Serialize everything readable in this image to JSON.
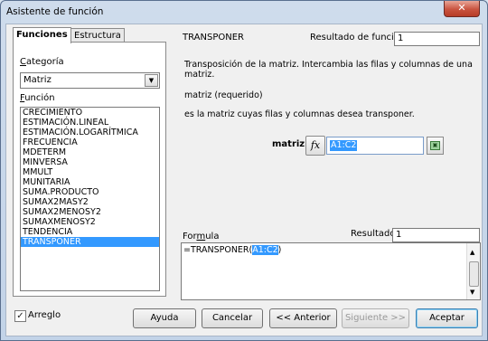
{
  "window": {
    "title": "Asistente de función",
    "close_glyph": "✕"
  },
  "tabs": {
    "funciones": "Funciones",
    "estructura": "Estructura"
  },
  "categoria": {
    "label": "Categoría",
    "value": "Matriz"
  },
  "funcion": {
    "label": "Función"
  },
  "functions": [
    {
      "label": "CRECIMIENTO",
      "selected": false
    },
    {
      "label": "ESTIMACIÓN.LINEAL",
      "selected": false
    },
    {
      "label": "ESTIMACIÓN.LOGARÍTMICA",
      "selected": false
    },
    {
      "label": "FRECUENCIA",
      "selected": false
    },
    {
      "label": "MDETERM",
      "selected": false
    },
    {
      "label": "MINVERSA",
      "selected": false
    },
    {
      "label": "MMULT",
      "selected": false
    },
    {
      "label": "MUNITARIA",
      "selected": false
    },
    {
      "label": "SUMA.PRODUCTO",
      "selected": false
    },
    {
      "label": "SUMAX2MASY2",
      "selected": false
    },
    {
      "label": "SUMAX2MENOSY2",
      "selected": false
    },
    {
      "label": "SUMAXMENOSY2",
      "selected": false
    },
    {
      "label": "TENDENCIA",
      "selected": false
    },
    {
      "label": "TRANSPONER",
      "selected": true
    }
  ],
  "detail": {
    "name": "TRANSPONER",
    "result_label": "Resultado de función",
    "result_value": "1",
    "description": "Transposición de la matriz. Intercambia las filas y columnas de una matriz.",
    "param_title": "matriz (requerido)",
    "param_desc": "es la matriz cuyas filas y columnas desea transponer.",
    "arg_label": "matriz",
    "fx_label": "fx",
    "arg_value": "A1:C2"
  },
  "formula": {
    "label": "Formula",
    "result_label": "Resultado",
    "result_value": "1",
    "prefix": "=TRANSPONER(",
    "highlight": "A1:C2",
    "suffix": ")"
  },
  "footer": {
    "arreglo_label": "Arreglo",
    "arreglo_checked": true,
    "ayuda": "Ayuda",
    "cancelar": "Cancelar",
    "anterior": "<< Anterior",
    "siguiente": "Siguiente >>",
    "aceptar": "Aceptar"
  },
  "colors": {
    "selection": "#3399ff",
    "window_frame": "#c2d3e8"
  }
}
